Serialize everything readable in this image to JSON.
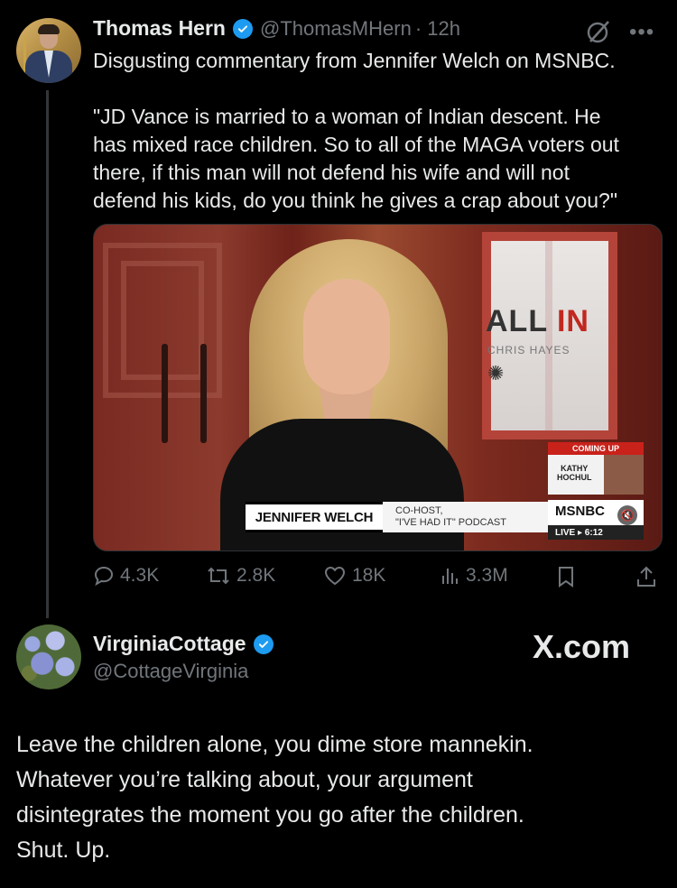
{
  "tweet": {
    "author_name": "Thomas Hern",
    "handle": "@ThomasMHern",
    "time": "· 12h",
    "text_line1": "Disgusting commentary from Jennifer Welch on MSNBC.",
    "quote": "\"JD Vance is married to a woman of Indian descent. He\nhas mixed race children. So to all of the MAGA voters out\nthere, if this man will not defend his wife and will not\ndefend his kids, do you think he gives a crap about you?\"",
    "video": {
      "show_title_a": "ALL",
      "show_title_b": "IN",
      "show_host": "CHRIS HAYES",
      "guest_name": "JENNIFER WELCH",
      "guest_title_line1": "CO-HOST,",
      "guest_title_line2": "\"I'VE HAD IT\" PODCAST",
      "coming_up": "COMING UP",
      "coming_up_name_line1": "KATHY",
      "coming_up_name_line2": "HOCHUL",
      "network": "MSNBC",
      "live": "LIVE ▸ 6:12"
    },
    "stats": {
      "replies": "4.3K",
      "reposts": "2.8K",
      "likes": "18K",
      "views": "3.3M"
    },
    "icons": [
      "verified-icon",
      "grok-icon",
      "more-icon",
      "reply-icon",
      "repost-icon",
      "like-icon",
      "views-icon",
      "bookmark-icon",
      "share-icon",
      "mute-icon"
    ]
  },
  "reply": {
    "author_name": "VirginiaCottage",
    "handle": "@CottageVirginia",
    "watermark": "X.com",
    "text": "Leave the children alone, you dime store mannekin.\nWhatever you’re talking about, your argument\ndisintegrates the moment you go after the children.\nShut. Up."
  },
  "colors": {
    "background": "#000000",
    "text": "#e7e9ea",
    "muted": "#71767b",
    "verified": "#1d9bf0"
  }
}
